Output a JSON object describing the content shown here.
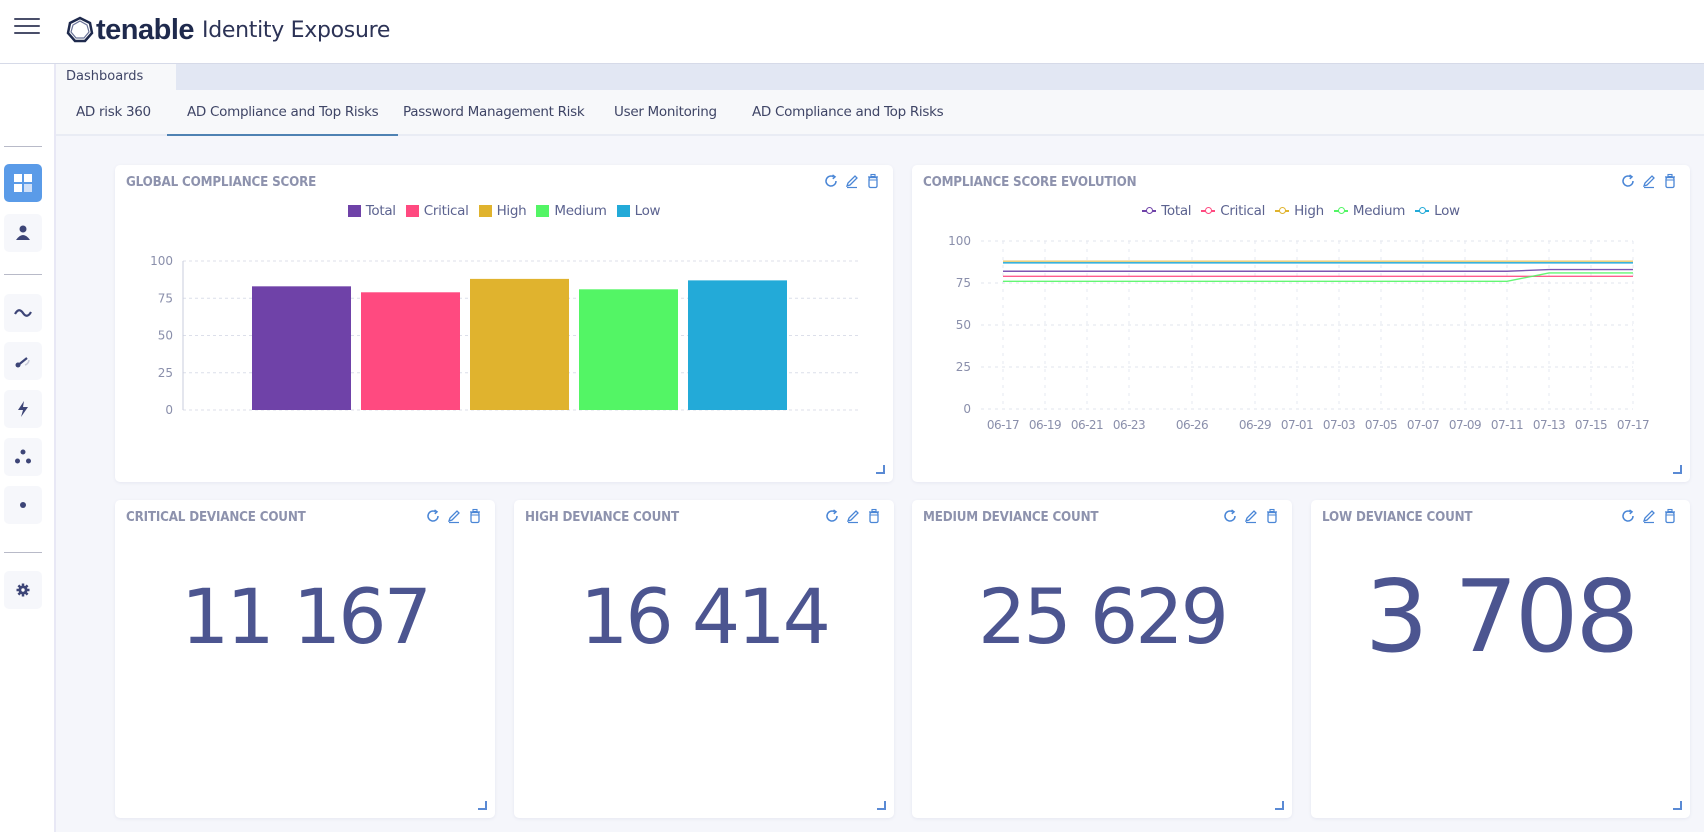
{
  "app": {
    "brand": "tenable",
    "product": "Identity Exposure"
  },
  "sidebar": {
    "items": [
      {
        "name": "dashboards",
        "icon": "dashboard-grid-icon",
        "active": true
      },
      {
        "name": "users",
        "icon": "user-icon",
        "active": false
      },
      {
        "name": "trail-flow",
        "icon": "wave-icon",
        "active": false
      },
      {
        "name": "indicators-of-exposure",
        "icon": "gauge-icon",
        "active": false
      },
      {
        "name": "indicators-of-attack",
        "icon": "lightning-icon",
        "active": false
      },
      {
        "name": "topology",
        "icon": "topology-dots-icon",
        "active": false
      },
      {
        "name": "attack-path",
        "icon": "dot-icon",
        "active": false
      },
      {
        "name": "settings",
        "icon": "gear-icon",
        "active": false
      }
    ]
  },
  "section_tab": "Dashboards",
  "tabs": [
    {
      "label": "AD risk 360",
      "active": false
    },
    {
      "label": "AD Compliance and Top Risks",
      "active": true
    },
    {
      "label": "Password Management Risk",
      "active": false
    },
    {
      "label": "User Monitoring",
      "active": false
    },
    {
      "label": "AD Compliance and Top Risks",
      "active": false
    }
  ],
  "widgets": {
    "global_compliance": {
      "title": "GLOBAL COMPLIANCE SCORE"
    },
    "compliance_evolution": {
      "title": "COMPLIANCE SCORE EVOLUTION"
    },
    "counts": [
      {
        "title": "CRITICAL DEVIANCE COUNT",
        "value": "11 167"
      },
      {
        "title": "HIGH DEVIANCE COUNT",
        "value": "16 414"
      },
      {
        "title": "MEDIUM DEVIANCE COUNT",
        "value": "25 629"
      },
      {
        "title": "LOW DEVIANCE COUNT",
        "value": "3 708"
      }
    ]
  },
  "colors": {
    "Total": "#6f42a8",
    "Critical": "#ff4a80",
    "High": "#e0b32e",
    "Medium": "#53f565",
    "Low": "#23aad8",
    "accent": "#5a9be8",
    "number": "#4c5590"
  },
  "chart_data": [
    {
      "type": "bar",
      "title": "GLOBAL COMPLIANCE SCORE",
      "categories": [
        "Total",
        "Critical",
        "High",
        "Medium",
        "Low"
      ],
      "series": [
        {
          "name": "Total",
          "values": [
            83
          ]
        },
        {
          "name": "Critical",
          "values": [
            79
          ]
        },
        {
          "name": "High",
          "values": [
            88
          ]
        },
        {
          "name": "Medium",
          "values": [
            81
          ]
        },
        {
          "name": "Low",
          "values": [
            87
          ]
        }
      ],
      "legend": [
        "Total",
        "Critical",
        "High",
        "Medium",
        "Low"
      ],
      "legend_position": "top",
      "yticks": [
        0,
        25,
        50,
        75,
        100
      ],
      "ylim": [
        0,
        100
      ],
      "grid": true,
      "xlabel": "",
      "ylabel": ""
    },
    {
      "type": "line",
      "title": "COMPLIANCE SCORE EVOLUTION",
      "x": [
        "06-17",
        "06-19",
        "06-21",
        "06-23",
        "06-26",
        "06-29",
        "07-01",
        "07-03",
        "07-05",
        "07-07",
        "07-09",
        "07-11",
        "07-13",
        "07-15",
        "07-17"
      ],
      "xticks": [
        "06-17",
        "06-19",
        "06-21",
        "06-23",
        "06-26",
        "06-29",
        "07-01",
        "07-03",
        "07-05",
        "07-07",
        "07-09",
        "07-11",
        "07-13",
        "07-15",
        "07-17"
      ],
      "x_days": [
        0,
        2,
        4,
        6,
        9,
        12,
        14,
        16,
        18,
        20,
        22,
        24,
        26,
        28,
        30
      ],
      "series": [
        {
          "name": "Total",
          "values": [
            82,
            82,
            82,
            82,
            82,
            82,
            82,
            82,
            82,
            82,
            82,
            82,
            83,
            83,
            83
          ]
        },
        {
          "name": "Critical",
          "values": [
            79,
            79,
            79,
            79,
            79,
            79,
            79,
            79,
            79,
            79,
            79,
            79,
            79,
            79,
            79
          ]
        },
        {
          "name": "High",
          "values": [
            88,
            88,
            88,
            88,
            88,
            88,
            88,
            88,
            88,
            88,
            88,
            88,
            88,
            88,
            88
          ]
        },
        {
          "name": "Medium",
          "values": [
            76,
            76,
            76,
            76,
            76,
            76,
            76,
            76,
            76,
            76,
            76,
            76,
            81,
            81,
            81
          ]
        },
        {
          "name": "Low",
          "values": [
            87,
            87,
            87,
            87,
            87,
            87,
            87,
            87,
            87,
            87,
            87,
            87,
            87,
            87,
            87
          ]
        }
      ],
      "legend": [
        "Total",
        "Critical",
        "High",
        "Medium",
        "Low"
      ],
      "legend_position": "top",
      "yticks": [
        0,
        25,
        50,
        75,
        100
      ],
      "ylim": [
        0,
        100
      ],
      "grid": true,
      "xlabel": "",
      "ylabel": ""
    }
  ]
}
